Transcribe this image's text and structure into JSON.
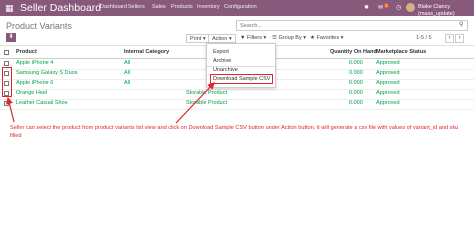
{
  "header": {
    "app_title": "Seller Dashboard",
    "menu": [
      "Dashboard",
      "Sellers",
      "Sales",
      "Products",
      "Inventory",
      "Configuration"
    ],
    "chat_count": "1",
    "user": "Blake Clancy (mass_update)"
  },
  "page": {
    "title": "Product Variants",
    "search_placeholder": "Search..."
  },
  "toolbar": {
    "print": "Print",
    "action": "Action",
    "filters": "Filters",
    "group_by": "Group By",
    "favorites": "Favorites",
    "pager": "1-5 / 5"
  },
  "table": {
    "headers": [
      "Product",
      "Internal Category",
      "Quantity On Hand",
      "Marketplace Status"
    ],
    "rows": [
      {
        "product": "Apple iPhone 4",
        "category": "All",
        "qty": "0.000",
        "status": "Approved"
      },
      {
        "product": "Samsung Galaxy S Duos",
        "category": "All",
        "qty": "0.000",
        "status": "Approved"
      },
      {
        "product": "Apple iPhone 6",
        "category": "All",
        "qty": "0.000",
        "status": "Approved"
      },
      {
        "product": "Orange Heel",
        "category": "Storable Product",
        "qty": "0.000",
        "status": "Approved"
      },
      {
        "product": "Leather Casual Shoe",
        "category": "Storable Product",
        "qty": "0.000",
        "status": "Approved"
      }
    ]
  },
  "action_menu": [
    "Export",
    "Archive",
    "Unarchive",
    "Download Sample CSV"
  ],
  "annotation": "Seller can select the product from product variants list view and click on Download Sample CSV button under Action button, it will generate a csv file with values of variant_id and sku filled",
  "colors": {
    "brand": "#875a7b",
    "annotation": "#e3242b",
    "approved": "#00a04a"
  }
}
